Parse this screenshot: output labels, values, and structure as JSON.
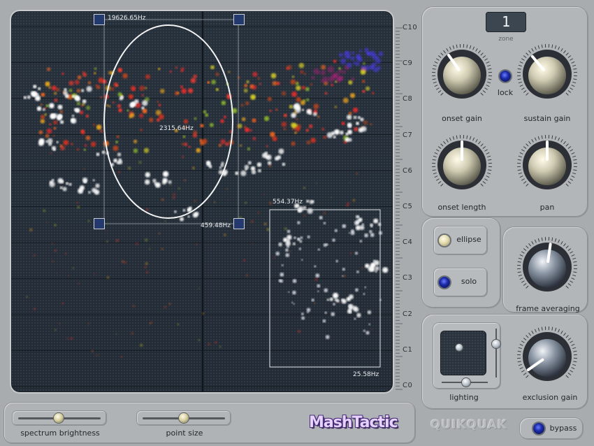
{
  "spectrum": {
    "notes": [
      "C10",
      "C9",
      "C8",
      "C7",
      "C6",
      "C5",
      "C4",
      "C3",
      "C2",
      "C1",
      "C0"
    ],
    "selection_ellipse": {
      "top_label": "19626.65Hz",
      "center_label": "2315.64Hz",
      "bottom_label": "459.48Hz"
    },
    "selection_rect": {
      "top_label": "554.37Hz",
      "bottom_label": "25.58Hz"
    }
  },
  "zone": {
    "value": "1",
    "label": "zone"
  },
  "knobs": {
    "onset_gain": "onset gain",
    "sustain_gain": "sustain gain",
    "onset_length": "onset length",
    "pan": "pan",
    "frame_averaging": "frame averaging",
    "exclusion_gain": "exclusion gain"
  },
  "lock": {
    "label": "lock"
  },
  "buttons": {
    "ellipse": "ellipse",
    "solo": "solo",
    "bypass": "bypass"
  },
  "lighting": {
    "label": "lighting"
  },
  "sliders": {
    "spectrum_brightness": "spectrum brightness",
    "point_size": "point size"
  },
  "brand": {
    "logo": "MashTactic",
    "maker": "QUIKQUAK"
  },
  "colors": {
    "accent_led": "#1b2aa6",
    "display_bg": "#27313d",
    "panel": "#b3b6b9"
  }
}
